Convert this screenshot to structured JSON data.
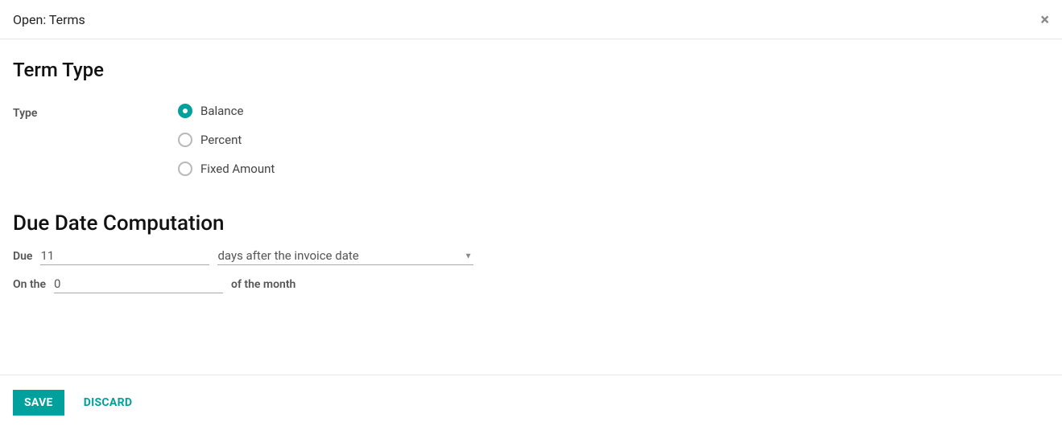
{
  "header": {
    "title": "Open: Terms"
  },
  "sections": {
    "termType": {
      "heading": "Term Type",
      "typeLabel": "Type",
      "options": {
        "balance": "Balance",
        "percent": "Percent",
        "fixed": "Fixed Amount"
      },
      "selected": "balance"
    },
    "dueDate": {
      "heading": "Due Date Computation",
      "dueLabel": "Due",
      "dueValue": "11",
      "dueSelect": "days after the invoice date",
      "onTheLabel": "On the",
      "onTheValue": "0",
      "ofMonthLabel": "of the month"
    }
  },
  "footer": {
    "save": "SAVE",
    "discard": "DISCARD"
  }
}
